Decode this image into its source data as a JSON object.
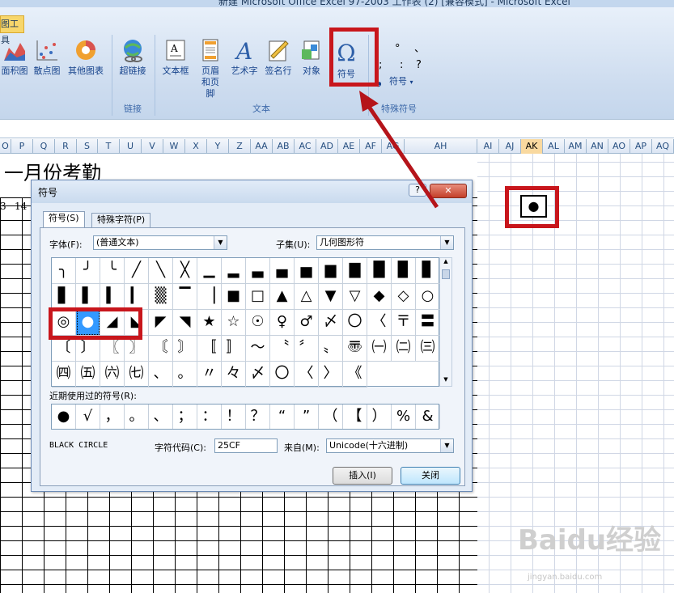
{
  "window": {
    "title": "新建 Microsoft Office Excel 97-2003 工作表 (2)  [兼容模式] - Microsoft Excel",
    "tool_tab": "图工具"
  },
  "ribbon": {
    "buttons": [
      {
        "label": "面积图",
        "icon": "area-chart-icon"
      },
      {
        "label": "散点图",
        "icon": "scatter-chart-icon"
      },
      {
        "label": "其他图表",
        "icon": "other-chart-icon"
      },
      {
        "label": "超链接",
        "icon": "hyperlink-icon"
      },
      {
        "label": "文本框",
        "icon": "textbox-icon"
      },
      {
        "label": "页眉和页脚",
        "icon": "header-footer-icon"
      },
      {
        "label": "艺术字",
        "icon": "wordart-icon"
      },
      {
        "label": "签名行",
        "icon": "signature-icon"
      },
      {
        "label": "对象",
        "icon": "object-icon"
      },
      {
        "label": "符号",
        "icon": "omega-icon"
      },
      {
        "label": "符号",
        "icon": "special-symbol-icon"
      }
    ],
    "groups": {
      "link": "链接",
      "text": "文本",
      "special": "特殊符号"
    }
  },
  "columns_left": [
    "O",
    "P",
    "Q",
    "R",
    "S",
    "T",
    "U",
    "V",
    "W",
    "X",
    "Y",
    "Z",
    "AA",
    "AB",
    "AC",
    "AD",
    "AE",
    "AF",
    "AG",
    "AH"
  ],
  "columns_right": [
    "AI",
    "AJ",
    "AK",
    "AL",
    "AM",
    "AN",
    "AO",
    "AP",
    "AQ"
  ],
  "selected_column": "AK",
  "sheet": {
    "title": "一月份考勤",
    "row_numbers": [
      "3",
      "14"
    ],
    "cell_symbol": "●"
  },
  "dialog": {
    "title": "符号",
    "help": "?",
    "close": "✕",
    "tabs": [
      "符号(S)",
      "特殊字符(P)"
    ],
    "font_label": "字体(F):",
    "font_value": "(普通文本)",
    "subset_label": "子集(U):",
    "subset_value": "几何图形符",
    "symbols": [
      "╮",
      "╯",
      "╰",
      "╱",
      "╲",
      "╳",
      "▁",
      "▂",
      "▃",
      "▄",
      "▅",
      "▆",
      "▇",
      "█",
      "▉",
      "▊",
      "▋",
      "▌",
      "▍",
      "▎",
      "▒",
      "▔",
      "▕",
      "■",
      "□",
      "▲",
      "△",
      "▼",
      "▽",
      "◆",
      "◇",
      "○",
      "◎",
      "●",
      "◢",
      "◣",
      "◤",
      "◥",
      "★",
      "☆",
      "☉",
      "♀",
      "♂",
      "〆",
      "〇",
      "〈",
      "〒",
      "〓",
      "〔",
      "〕",
      "〖",
      "〗",
      "〘",
      "〙",
      "〚",
      "〛",
      "〜",
      "〝",
      "〞",
      "〟",
      "〠",
      "㈠",
      "㈡",
      "㈢",
      "㈣",
      "㈤",
      "㈥",
      "㈦",
      "、",
      "。",
      "〃",
      "々",
      "〆",
      "〇",
      "〈",
      "〉",
      "《"
    ],
    "recent_label": "近期使用过的符号(R):",
    "recent": [
      "●",
      "√",
      "，",
      "。",
      "、",
      "；",
      "：",
      "！",
      "？",
      "“",
      "”",
      "（",
      "【",
      "）",
      "%",
      "&"
    ],
    "char_name": "BLACK CIRCLE",
    "code_label": "字符代码(C):",
    "code_value": "25CF",
    "from_label": "来自(M):",
    "from_value": "Unicode(十六进制)",
    "insert": "插入(I)",
    "close_btn": "关闭"
  },
  "watermark": {
    "brand": "Baidu经验",
    "url": "jingyan.baidu.com"
  }
}
